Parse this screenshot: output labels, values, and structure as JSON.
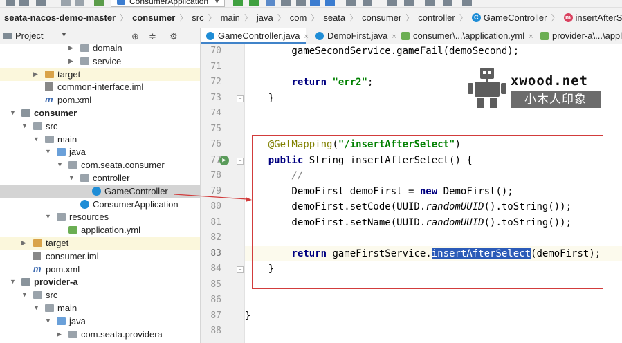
{
  "toolbar": {
    "run_config": "ConsumerApplication"
  },
  "breadcrumb": [
    {
      "label": "seata-nacos-demo-master",
      "bold": true,
      "icon": ""
    },
    {
      "label": "consumer",
      "bold": true,
      "icon": ""
    },
    {
      "label": "src",
      "bold": false,
      "icon": ""
    },
    {
      "label": "main",
      "bold": false,
      "icon": ""
    },
    {
      "label": "java",
      "bold": false,
      "icon": ""
    },
    {
      "label": "com",
      "bold": false,
      "icon": ""
    },
    {
      "label": "seata",
      "bold": false,
      "icon": ""
    },
    {
      "label": "consumer",
      "bold": false,
      "icon": ""
    },
    {
      "label": "controller",
      "bold": false,
      "icon": ""
    },
    {
      "label": "GameController",
      "bold": false,
      "icon": "class-icon",
      "glyph": "C"
    },
    {
      "label": "insertAfterSelect",
      "bold": false,
      "icon": "method-icon",
      "glyph": "m"
    }
  ],
  "project_panel": {
    "title": "Project"
  },
  "tree": [
    {
      "label": "domain",
      "icon": "folder-icon",
      "type": "folder",
      "state": "collapsed",
      "excluded": false,
      "selected": false,
      "bold": false
    },
    {
      "label": "service",
      "icon": "folder-icon",
      "type": "folder",
      "state": "collapsed",
      "excluded": false,
      "selected": false,
      "bold": false
    },
    {
      "label": "target",
      "icon": "target-folder-icon",
      "type": "folder-target",
      "state": "collapsed",
      "excluded": true,
      "selected": false,
      "bold": false
    },
    {
      "label": "common-interface.iml",
      "icon": "iml-file-icon",
      "type": "iml",
      "state": "leaf",
      "excluded": false,
      "selected": false,
      "bold": false
    },
    {
      "label": "pom.xml",
      "icon": "maven-icon",
      "type": "maven",
      "state": "leaf",
      "excluded": false,
      "selected": false,
      "bold": false
    },
    {
      "label": "consumer",
      "icon": "module-icon",
      "type": "module",
      "state": "expanded",
      "excluded": false,
      "selected": false,
      "bold": true
    },
    {
      "label": "src",
      "icon": "folder-icon",
      "type": "folder",
      "state": "expanded",
      "excluded": false,
      "selected": false,
      "bold": false
    },
    {
      "label": "main",
      "icon": "folder-icon",
      "type": "folder",
      "state": "expanded",
      "excluded": false,
      "selected": false,
      "bold": false
    },
    {
      "label": "java",
      "icon": "source-folder-icon",
      "type": "folder-src",
      "state": "expanded",
      "excluded": false,
      "selected": false,
      "bold": false
    },
    {
      "label": "com.seata.consumer",
      "icon": "package-icon",
      "type": "folder",
      "state": "expanded",
      "excluded": false,
      "selected": false,
      "bold": false
    },
    {
      "label": "controller",
      "icon": "package-icon",
      "type": "folder",
      "state": "expanded",
      "excluded": false,
      "selected": false,
      "bold": false
    },
    {
      "label": "GameController",
      "icon": "class-icon",
      "type": "java-class",
      "state": "leaf",
      "excluded": false,
      "selected": true,
      "bold": false
    },
    {
      "label": "ConsumerApplication",
      "icon": "class-icon",
      "type": "java-class",
      "state": "leaf",
      "excluded": false,
      "selected": false,
      "bold": false
    },
    {
      "label": "resources",
      "icon": "resources-folder-icon",
      "type": "folder-res",
      "state": "expanded",
      "excluded": false,
      "selected": false,
      "bold": false
    },
    {
      "label": "application.yml",
      "icon": "yml-file-icon",
      "type": "yml",
      "state": "leaf",
      "excluded": false,
      "selected": false,
      "bold": false
    },
    {
      "label": "target",
      "icon": "target-folder-icon",
      "type": "folder-target",
      "state": "collapsed",
      "excluded": true,
      "selected": false,
      "bold": false
    },
    {
      "label": "consumer.iml",
      "icon": "iml-file-icon",
      "type": "iml",
      "state": "leaf",
      "excluded": false,
      "selected": false,
      "bold": false
    },
    {
      "label": "pom.xml",
      "icon": "maven-icon",
      "type": "maven",
      "state": "leaf",
      "excluded": false,
      "selected": false,
      "bold": false
    },
    {
      "label": "provider-a",
      "icon": "module-icon",
      "type": "module",
      "state": "expanded",
      "excluded": false,
      "selected": false,
      "bold": true
    },
    {
      "label": "src",
      "icon": "folder-icon",
      "type": "folder",
      "state": "expanded",
      "excluded": false,
      "selected": false,
      "bold": false
    },
    {
      "label": "main",
      "icon": "folder-icon",
      "type": "folder",
      "state": "expanded",
      "excluded": false,
      "selected": false,
      "bold": false
    },
    {
      "label": "java",
      "icon": "source-folder-icon",
      "type": "folder-src",
      "state": "expanded",
      "excluded": false,
      "selected": false,
      "bold": false
    },
    {
      "label": "com.seata.providera",
      "icon": "package-icon",
      "type": "folder",
      "state": "collapsed",
      "excluded": false,
      "selected": false,
      "bold": false
    }
  ],
  "tabs": [
    {
      "label": "GameController.java",
      "icon": "class-icon",
      "active": true
    },
    {
      "label": "DemoFirst.java",
      "icon": "class-icon",
      "active": false
    },
    {
      "label": "consumer\\...\\application.yml",
      "icon": "yml-file-icon",
      "active": false
    },
    {
      "label": "provider-a\\...\\appl",
      "icon": "yml-file-icon",
      "active": false
    }
  ],
  "editor": {
    "active_line": 83,
    "lines": [
      {
        "n": 70,
        "tokens": [
          {
            "t": "        gameSecondService.gameFail(demoSecond);",
            "c": ""
          }
        ]
      },
      {
        "n": 71,
        "tokens": []
      },
      {
        "n": 72,
        "tokens": [
          {
            "t": "        ",
            "c": ""
          },
          {
            "t": "return",
            "c": "kw"
          },
          {
            "t": " ",
            "c": ""
          },
          {
            "t": "\"err2\"",
            "c": "str"
          },
          {
            "t": ";",
            "c": ""
          }
        ]
      },
      {
        "n": 73,
        "tokens": [
          {
            "t": "    }",
            "c": ""
          }
        ]
      },
      {
        "n": 74,
        "tokens": []
      },
      {
        "n": 75,
        "tokens": []
      },
      {
        "n": 76,
        "tokens": [
          {
            "t": "    ",
            "c": ""
          },
          {
            "t": "@GetMapping",
            "c": "ann"
          },
          {
            "t": "(",
            "c": ""
          },
          {
            "t": "\"/insertAfterSelect\"",
            "c": "str"
          },
          {
            "t": ")",
            "c": ""
          }
        ]
      },
      {
        "n": 77,
        "tokens": [
          {
            "t": "    ",
            "c": ""
          },
          {
            "t": "public",
            "c": "kw"
          },
          {
            "t": " String insertAfterSelect() {",
            "c": ""
          }
        ]
      },
      {
        "n": 78,
        "tokens": [
          {
            "t": "        ",
            "c": ""
          },
          {
            "t": "//",
            "c": "cmt"
          }
        ]
      },
      {
        "n": 79,
        "tokens": [
          {
            "t": "        DemoFirst demoFirst = ",
            "c": ""
          },
          {
            "t": "new",
            "c": "kw"
          },
          {
            "t": " DemoFirst();",
            "c": ""
          }
        ]
      },
      {
        "n": 80,
        "tokens": [
          {
            "t": "        demoFirst.setCode(UUID.",
            "c": ""
          },
          {
            "t": "randomUUID",
            "c": "ital"
          },
          {
            "t": "().toString());",
            "c": ""
          }
        ]
      },
      {
        "n": 81,
        "tokens": [
          {
            "t": "        demoFirst.setName(UUID.",
            "c": ""
          },
          {
            "t": "randomUUID",
            "c": "ital"
          },
          {
            "t": "().toString());",
            "c": ""
          }
        ]
      },
      {
        "n": 82,
        "tokens": []
      },
      {
        "n": 83,
        "tokens": [
          {
            "t": "        ",
            "c": ""
          },
          {
            "t": "return",
            "c": "kw"
          },
          {
            "t": " gameFirstService.",
            "c": ""
          },
          {
            "t": "insertAfterSelect",
            "c": "hl"
          },
          {
            "t": "(demoFirst);",
            "c": ""
          }
        ]
      },
      {
        "n": 84,
        "tokens": [
          {
            "t": "    }",
            "c": ""
          }
        ]
      },
      {
        "n": 85,
        "tokens": []
      },
      {
        "n": 86,
        "tokens": []
      },
      {
        "n": 87,
        "tokens": [
          {
            "t": "}",
            "c": ""
          }
        ]
      },
      {
        "n": 88,
        "tokens": []
      }
    ]
  },
  "watermark": {
    "domain": "xwood.net",
    "chinese": "小木人印象"
  },
  "colors": {
    "annotation_red": "#d23c3c",
    "selection_blue": "#2c5bb8",
    "keyword": "#000080",
    "string": "#008000"
  }
}
